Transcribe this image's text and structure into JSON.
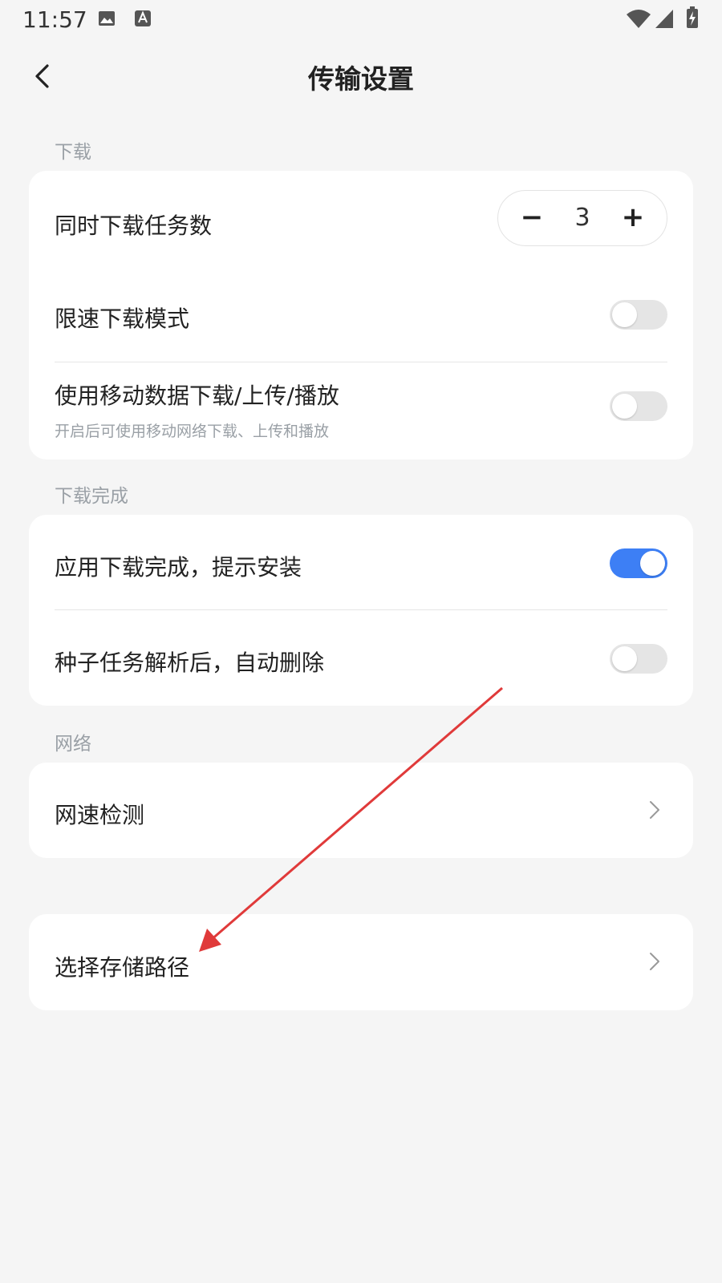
{
  "status_bar": {
    "time": "11:57",
    "left_icons": [
      "image-icon",
      "font-icon"
    ],
    "right_icons": [
      "wifi-icon",
      "signal-icon",
      "battery-charging-icon"
    ]
  },
  "header": {
    "title": "传输设置",
    "back_icon": "chevron-left-icon"
  },
  "sections": {
    "download": {
      "label": "下载",
      "concurrent": {
        "label": "同时下载任务数",
        "value": "3",
        "minus": "−",
        "plus": "+"
      },
      "speed_limit": {
        "label": "限速下载模式",
        "enabled": false
      },
      "mobile_data": {
        "label": "使用移动数据下载/上传/播放",
        "sub": "开启后可使用移动网络下载、上传和播放",
        "enabled": false
      }
    },
    "download_complete": {
      "label": "下载完成",
      "install_prompt": {
        "label": "应用下载完成，提示安装",
        "enabled": true
      },
      "torrent_delete": {
        "label": "种子任务解析后，自动删除",
        "enabled": false
      }
    },
    "network": {
      "label": "网络",
      "speed_test": {
        "label": "网速检测"
      }
    },
    "storage": {
      "path": {
        "label": "选择存储路径"
      }
    }
  },
  "colors": {
    "background": "#f5f5f5",
    "card": "#ffffff",
    "accent": "#3d7ff5",
    "annotation_arrow": "#e03a3a"
  }
}
